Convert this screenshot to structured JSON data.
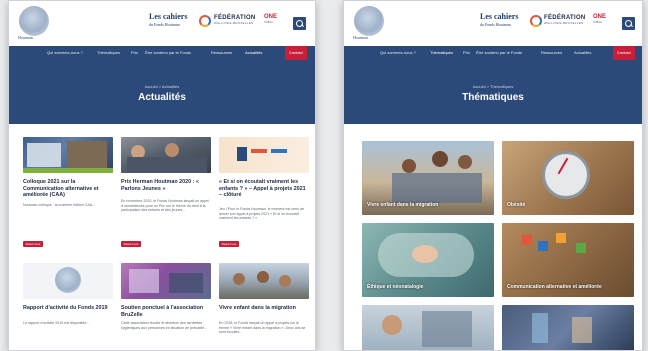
{
  "brand": {
    "logo_text": "Houtman",
    "title": "Les cahiers",
    "subtitle": "du Fonds Houtman",
    "federation": "FÉDÉRATION",
    "federation_sub": "WALLONIE-BRUXELLES",
    "fse": "ONE",
    "fse_sub": "l'Office"
  },
  "nav": {
    "items": [
      "Qui sommes-nous ?",
      "Thématiques",
      "Prix",
      "Être soutenu par le Fonds",
      "Ressources",
      "Actualités"
    ],
    "contact": "Contact"
  },
  "left_page": {
    "breadcrumb": "Accueil > Actualités",
    "title": "Actualités",
    "active_nav": "Actualités",
    "cards": [
      {
        "title": "Colloque 2021 sur la Communication alternative et améliorée (CAA)",
        "text": "Nouveau colloque : la onzième édition CAA...",
        "button": "Read more"
      },
      {
        "title": "Prix Herman Houtman 2020 : « Parlons Jeunes »",
        "text": "En novembre 2020, le Fonds Houtman lançait un appel à candidatures pour un Prix sur le thème du droit à la participation des enfants et des jeunes...",
        "button": "Read more"
      },
      {
        "title": "« Et si on écoutait vraiment les enfants ? » – Appel à projets 2021 – clôturé",
        "text": "Jeu ! Pour le Fonds Houtman, le moment est venu de lancer son appel à projets 2021 « Et si on écoutait vraiment les enfants ? »",
        "button": "Read more"
      },
      {
        "title": "Rapport d'activité du Fonds 2019",
        "text": "Le rapport d'activité 2019 est disponible...",
        "button": ""
      },
      {
        "title": "Soutien ponctuel à l'association BruZelle",
        "text": "Cette association récolte et distribue des serviettes hygiéniques aux personnes en situation de précarité...",
        "button": ""
      },
      {
        "title": "Vivre enfant dans la migration",
        "text": "En 2018, le Fonds lançait un appel à projets sur le thème « Vivre enfant dans la migration ». Deux ans se sont écoulés...",
        "button": ""
      }
    ]
  },
  "right_page": {
    "breadcrumb": "Accueil > Thématiques",
    "title": "Thématiques",
    "active_nav": "Thématiques",
    "tiles": [
      {
        "label": "Vivre enfant dans la migration"
      },
      {
        "label": "Obésité"
      },
      {
        "label": "Éthique et néonatalogie"
      },
      {
        "label": "Communication alternative et améliorée"
      },
      {
        "label": ""
      },
      {
        "label": ""
      }
    ]
  },
  "colors": {
    "navy": "#2b4a7a",
    "red": "#c71f3a",
    "page_bg": "#e9ebee"
  }
}
